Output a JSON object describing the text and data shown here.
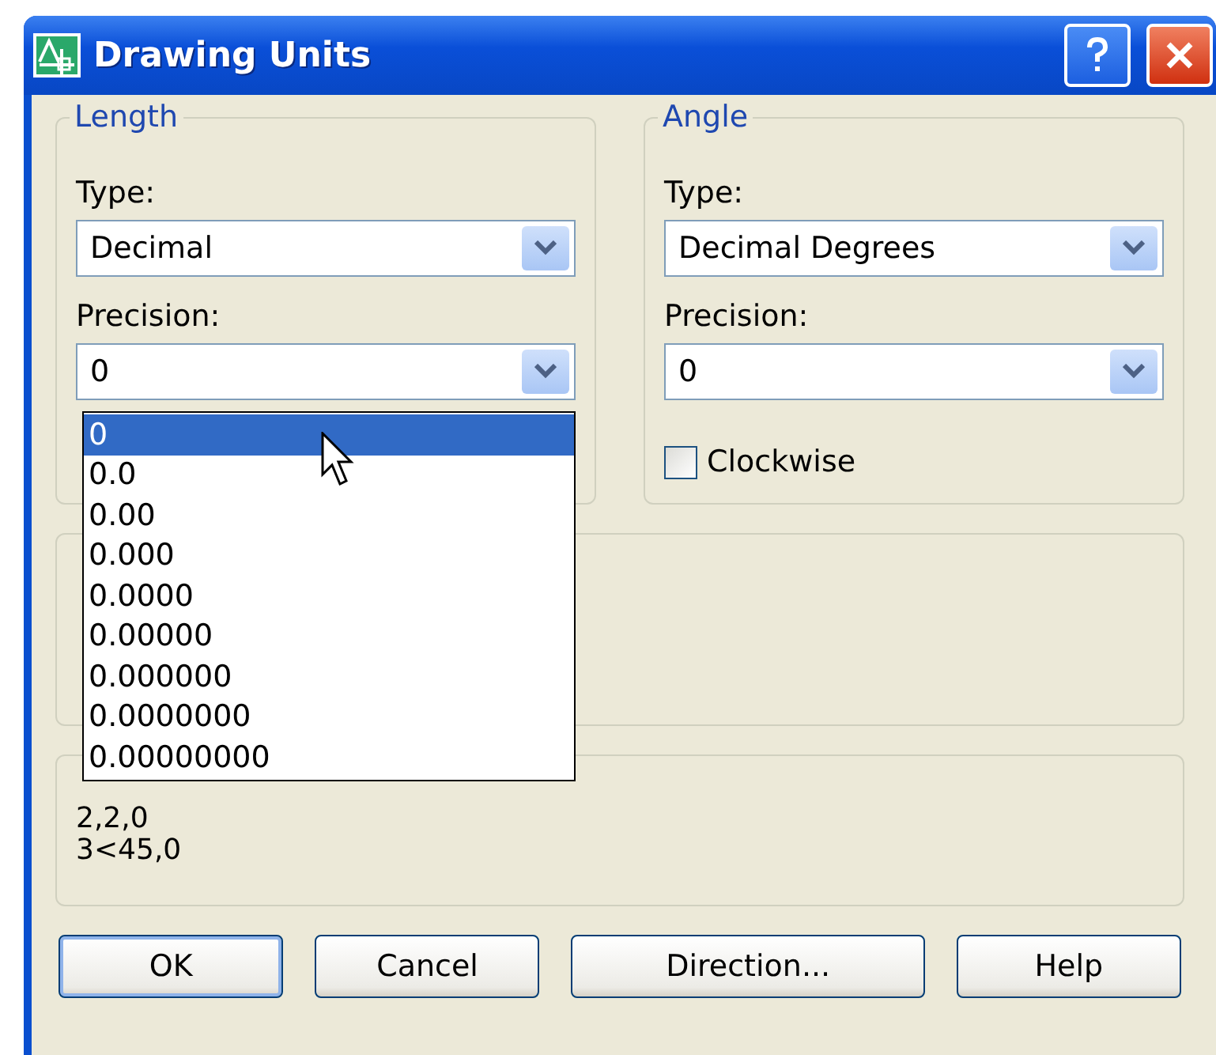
{
  "window": {
    "title": "Drawing Units"
  },
  "length": {
    "legend": "Length",
    "type_label": "Type:",
    "type_value": "Decimal",
    "precision_label": "Precision:",
    "precision_value": "0",
    "precision_options": [
      {
        "label": "0",
        "selected": true
      },
      {
        "label": "0.0",
        "selected": false
      },
      {
        "label": "0.00",
        "selected": false
      },
      {
        "label": "0.000",
        "selected": false
      },
      {
        "label": "0.0000",
        "selected": false
      },
      {
        "label": "0.00000",
        "selected": false
      },
      {
        "label": "0.000000",
        "selected": false
      },
      {
        "label": "0.0000000",
        "selected": false
      },
      {
        "label": "0.00000000",
        "selected": false
      }
    ]
  },
  "angle": {
    "legend": "Angle",
    "type_label": "Type:",
    "type_value": "Decimal Degrees",
    "precision_label": "Precision:",
    "precision_value": "0",
    "clockwise": {
      "label": "Clockwise",
      "checked": false
    }
  },
  "sample_output": {
    "lines": [
      "2,2,0",
      "3<45,0"
    ]
  },
  "buttons": [
    {
      "label": "OK",
      "default": true
    },
    {
      "label": "Cancel",
      "default": false
    },
    {
      "label": "Direction...",
      "default": false
    },
    {
      "label": "Help",
      "default": false
    }
  ]
}
